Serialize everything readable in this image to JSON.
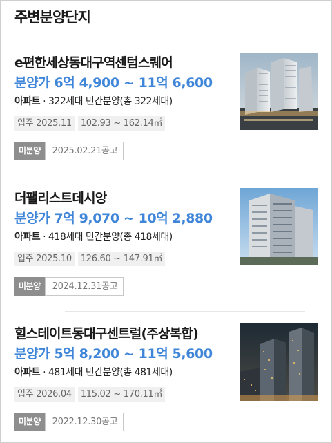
{
  "section": {
    "title": "주변분양단지"
  },
  "items": [
    {
      "name": "e편한세상동대구역센텀스퀘어",
      "price": "분양가 6억 4,900 ~ 11억 6,600",
      "type": "아파트",
      "units": "322세대 민간분양(총 322세대)",
      "movein": "입주 2025.11",
      "area": "102.93 ~ 162.14㎡",
      "status": "미분양",
      "notice": "2025.02.21공고",
      "thumb_alt": "apartment-complex-render"
    },
    {
      "name": "더팰리스트데시앙",
      "price": "분양가 7억 9,070 ~ 10억 2,880",
      "type": "아파트",
      "units": "418세대 민간분양(총 418세대)",
      "movein": "입주 2025.10",
      "area": "126.60 ~ 147.91㎡",
      "status": "미분양",
      "notice": "2024.12.31공고",
      "thumb_alt": "apartment-tower-render"
    },
    {
      "name": "힐스테이트동대구센트럴(주상복합)",
      "price": "분양가 5억 8,200 ~ 11억 5,600",
      "type": "아파트",
      "units": "481세대 민간분양(총 481세대)",
      "movein": "입주 2026.04",
      "area": "115.02 ~ 170.11㎡",
      "status": "미분양",
      "notice": "2022.12.30공고",
      "thumb_alt": "night-city-towers-render"
    }
  ],
  "colors": {
    "price": "#3f86d9",
    "badge": "#8e8e8e",
    "chip_bg": "#f0f0f0"
  }
}
